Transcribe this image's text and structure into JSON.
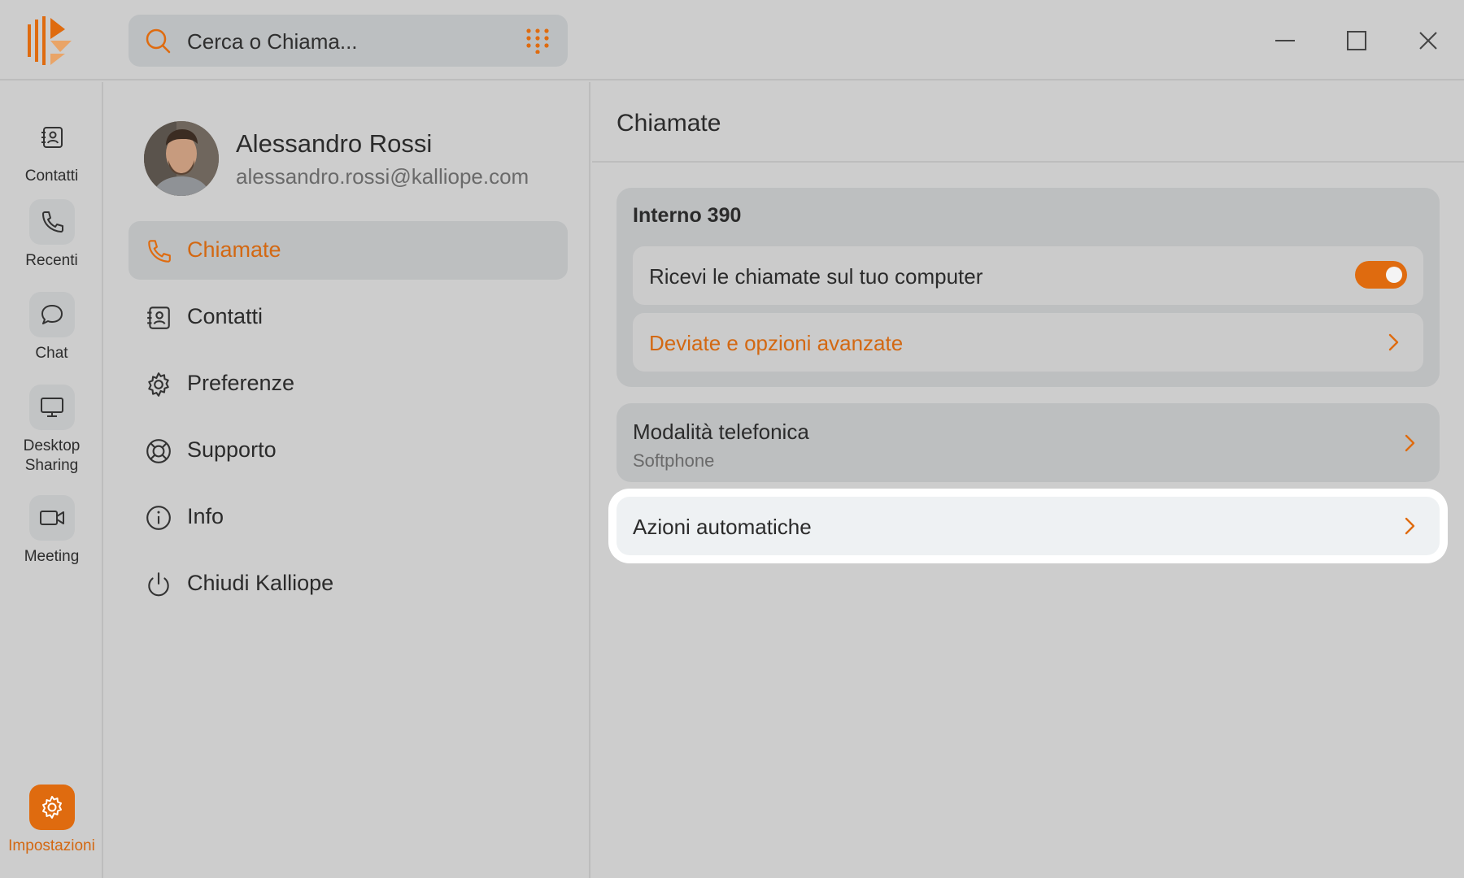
{
  "app": {
    "brand_color": "#df6b0f",
    "window_controls": [
      "minimize-icon",
      "maximize-icon",
      "close-icon"
    ]
  },
  "search": {
    "placeholder": "Cerca o Chiama...",
    "icon": "search-icon",
    "dialpad_icon": "dialpad-icon"
  },
  "rail": {
    "items": [
      {
        "label": "Contatti",
        "icon": "contacts-icon"
      },
      {
        "label": "Recenti",
        "icon": "phone-icon"
      },
      {
        "label": "Chat",
        "icon": "chat-bubble-icon"
      },
      {
        "label": "Desktop Sharing",
        "icon": "monitor-icon"
      },
      {
        "label": "Meeting",
        "icon": "video-camera-icon"
      }
    ],
    "settings": {
      "label": "Impostazioni",
      "icon": "gear-icon",
      "active": true
    }
  },
  "profile": {
    "name": "Alessandro Rossi",
    "email": "alessandro.rossi@kalliope.com"
  },
  "menu": {
    "items": [
      {
        "label": "Chiamate",
        "icon": "phone-icon",
        "active": true
      },
      {
        "label": "Contatti",
        "icon": "contacts-icon"
      },
      {
        "label": "Preferenze",
        "icon": "gear-icon"
      },
      {
        "label": "Supporto",
        "icon": "lifebuoy-icon"
      },
      {
        "label": "Info",
        "icon": "info-icon"
      },
      {
        "label": "Chiudi Kalliope",
        "icon": "power-icon"
      }
    ]
  },
  "detail": {
    "title": "Chiamate",
    "extension": {
      "title": "Interno 390",
      "receive_calls_label": "Ricevi le chiamate sul tuo computer",
      "receive_calls_enabled": true,
      "forwarding_label": "Deviate e opzioni avanzate"
    },
    "phone_mode": {
      "title": "Modalità telefonica",
      "value": "Softphone"
    },
    "auto_actions": {
      "title": "Azioni automatiche"
    }
  }
}
